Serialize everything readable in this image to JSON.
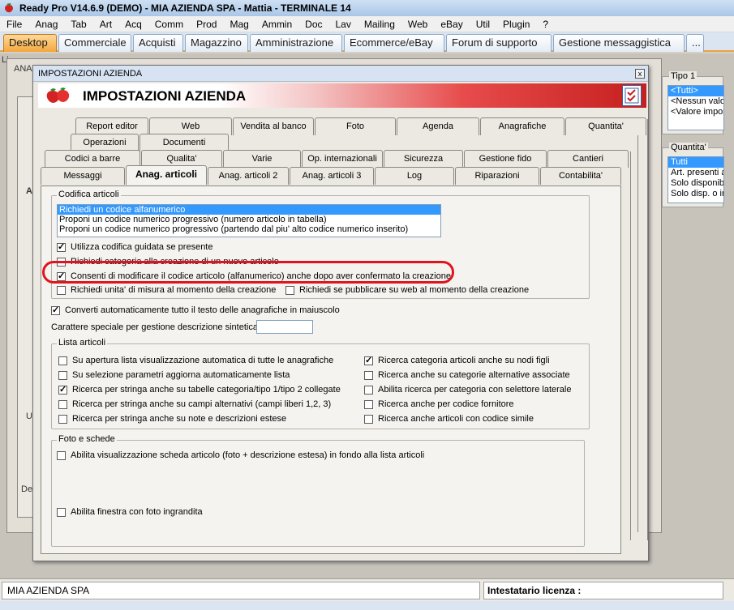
{
  "window": {
    "title": "Ready Pro V14.6.9 (DEMO) - MIA AZIENDA SPA - Mattia - TERMINALE 14"
  },
  "menu": [
    "File",
    "Anag",
    "Tab",
    "Art",
    "Acq",
    "Comm",
    "Prod",
    "Mag",
    "Ammin",
    "Doc",
    "Lav",
    "Mailing",
    "Web",
    "eBay",
    "Util",
    "Plugin",
    "?"
  ],
  "module_tabs": [
    "Desktop",
    "Commerciale",
    "Acquisti",
    "Magazzino",
    "Amministrazione",
    "Ecommerce/eBay",
    "Forum di supporto",
    "Gestione messaggistica",
    "..."
  ],
  "background": {
    "lia_label": "Li",
    "ana_label": "ANA",
    "left_labels": [
      "A",
      "U",
      "De"
    ]
  },
  "right_panels": {
    "tipo": {
      "label": "Tipo 1",
      "items": [
        "<Tutti>",
        "<Nessun valore>",
        "<Valore impostato>"
      ]
    },
    "quantita": {
      "label": "Quantita'",
      "items": [
        "Tutti",
        "Art. presenti a",
        "Solo disponibili",
        "Solo disp. o in"
      ]
    }
  },
  "status": {
    "company": "MIA AZIENDA SPA",
    "license_label": "Intestatario licenza :"
  },
  "dialog": {
    "title": "IMPOSTAZIONI AZIENDA",
    "header": "IMPOSTAZIONI AZIENDA",
    "close": "x",
    "tabs_row1": [
      "Report editor",
      "Web",
      "Vendita al banco",
      "Foto",
      "Agenda",
      "Anagrafiche",
      "Quantita'"
    ],
    "tabs_row2": [
      "Operazioni",
      "Documenti"
    ],
    "tabs_row3": [
      "Codici a barre",
      "Qualita'",
      "Varie",
      "Op. internazionali",
      "Sicurezza",
      "Gestione fido",
      "Cantieri"
    ],
    "tabs_row4": [
      "Messaggi",
      "Anag. articoli",
      "Anag. articoli 2",
      "Anag. articoli 3",
      "Log",
      "Riparazioni",
      "Contabilita'"
    ],
    "codifica": {
      "label": "Codifica articoli",
      "options": [
        "Richiedi un codice alfanumerico",
        "Proponi un codice numerico progressivo (numero articolo in tabella)",
        "Proponi un codice numerico progressivo (partendo dal piu' alto codice numerico inserito)"
      ],
      "selected": 0,
      "checks": [
        {
          "label": "Utilizza codifica guidata se presente",
          "checked": true
        },
        {
          "label": "Richiedi categoria alla creazione di un nuovo articolo",
          "checked": false
        },
        {
          "label": "Consenti di modificare il codice articolo (alfanumerico) anche dopo aver confermato la creazione",
          "checked": true
        },
        {
          "label": "Richiedi unita' di misura al momento della creazione",
          "checked": false
        },
        {
          "label": "Richiedi se pubblicare su web al momento della creazione",
          "checked": false
        }
      ]
    },
    "converti": {
      "label": "Converti automaticamente tutto il testo delle anagrafiche in maiuscolo",
      "checked": true
    },
    "carattere_label": "Carattere speciale per gestione descrizione sintetica :",
    "carattere_value": "",
    "lista": {
      "label": "Lista articoli",
      "left": [
        {
          "label": "Su apertura lista visualizzazione automatica di tutte le anagrafiche",
          "checked": false
        },
        {
          "label": "Su selezione parametri aggiorna automaticamente lista",
          "checked": false
        },
        {
          "label": "Ricerca per stringa anche su tabelle categoria/tipo 1/tipo 2 collegate",
          "checked": true
        },
        {
          "label": "Ricerca per stringa anche su campi alternativi (campi liberi 1,2, 3)",
          "checked": false
        },
        {
          "label": "Ricerca per stringa anche su note e descrizioni estese",
          "checked": false
        }
      ],
      "right": [
        {
          "label": "Ricerca categoria articoli anche su nodi figli",
          "checked": true
        },
        {
          "label": "Ricerca anche su categorie alternative associate",
          "checked": false
        },
        {
          "label": "Abilita ricerca per categoria con selettore laterale",
          "checked": false
        },
        {
          "label": "Ricerca anche per codice fornitore",
          "checked": false
        },
        {
          "label": "Ricerca anche articoli con codice simile",
          "checked": false
        }
      ]
    },
    "foto": {
      "label": "Foto e schede",
      "checks": [
        {
          "label": "Abilita visualizzazione scheda articolo (foto + descrizione estesa) in fondo alla lista articoli",
          "checked": false
        },
        {
          "label": "Abilita finestra con foto ingrandita",
          "checked": false
        }
      ]
    }
  }
}
